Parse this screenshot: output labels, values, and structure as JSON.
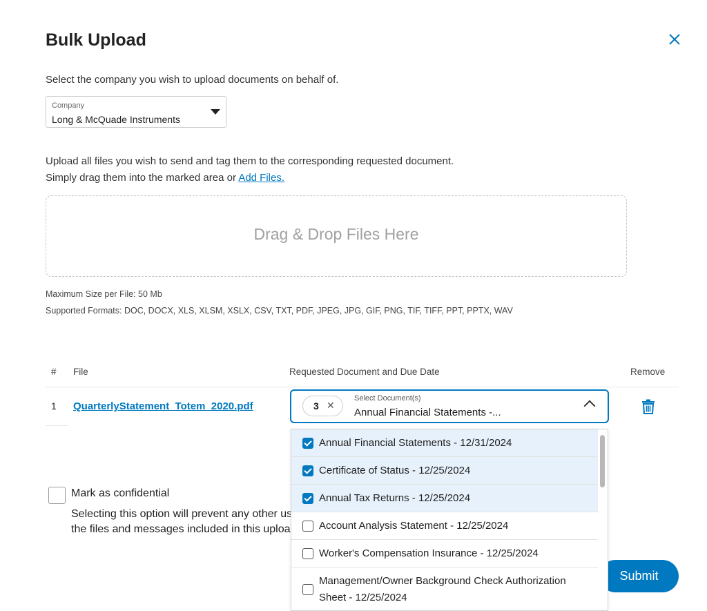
{
  "dialog": {
    "title": "Bulk Upload",
    "intro": "Select the company you wish to upload documents on behalf of."
  },
  "company": {
    "label": "Company",
    "value": "Long & McQuade Instruments"
  },
  "upload": {
    "help_line1": "Upload all files you wish to send and tag them to the corresponding requested document.",
    "help_line2_prefix": "Simply drag them into the marked area or ",
    "add_files_link": "Add Files.",
    "drop_zone": "Drag & Drop Files Here",
    "max_size": "Maximum Size per File: 50 Mb",
    "formats": "Supported Formats: DOC, DOCX, XLS, XLSM, XSLX, CSV, TXT, PDF, JPEG, JPG, GIF, PNG, TIF, TIFF, PPT, PPTX, WAV"
  },
  "table": {
    "headers": {
      "num": "#",
      "file": "File",
      "requested": "Requested Document and Due Date",
      "remove": "Remove"
    },
    "rows": [
      {
        "num": "1",
        "file": "QuarterlyStatement_Totem_2020.pdf",
        "selected_count": "3",
        "select_label": "Select Document(s)",
        "select_value": "Annual Financial Statements -..."
      }
    ]
  },
  "dropdown": {
    "options": [
      {
        "label": "Annual Financial Statements - 12/31/2024",
        "checked": true
      },
      {
        "label": "Certificate of Status - 12/25/2024",
        "checked": true
      },
      {
        "label": "Annual Tax Returns - 12/25/2024",
        "checked": true
      },
      {
        "label": "Account Analysis Statement - 12/25/2024",
        "checked": false
      },
      {
        "label": "Worker's Compensation Insurance - 12/25/2024",
        "checked": false
      },
      {
        "label": "Management/Owner Background Check Authorization Sheet - 12/25/2024",
        "checked": false
      }
    ]
  },
  "confidential": {
    "label": "Mark as confidential",
    "desc_line1": "Selecting this option will prevent any other user",
    "desc_line2": "the files and messages included in this upload."
  },
  "actions": {
    "submit": "Submit"
  },
  "colors": {
    "accent": "#0079c1",
    "selected_option_bg": "#e7f1fb"
  },
  "icons": {
    "close": "close-icon",
    "caret": "caret-down-icon",
    "chip_remove": "close-icon",
    "chevron": "chevron-up-icon",
    "trash": "trash-icon"
  }
}
